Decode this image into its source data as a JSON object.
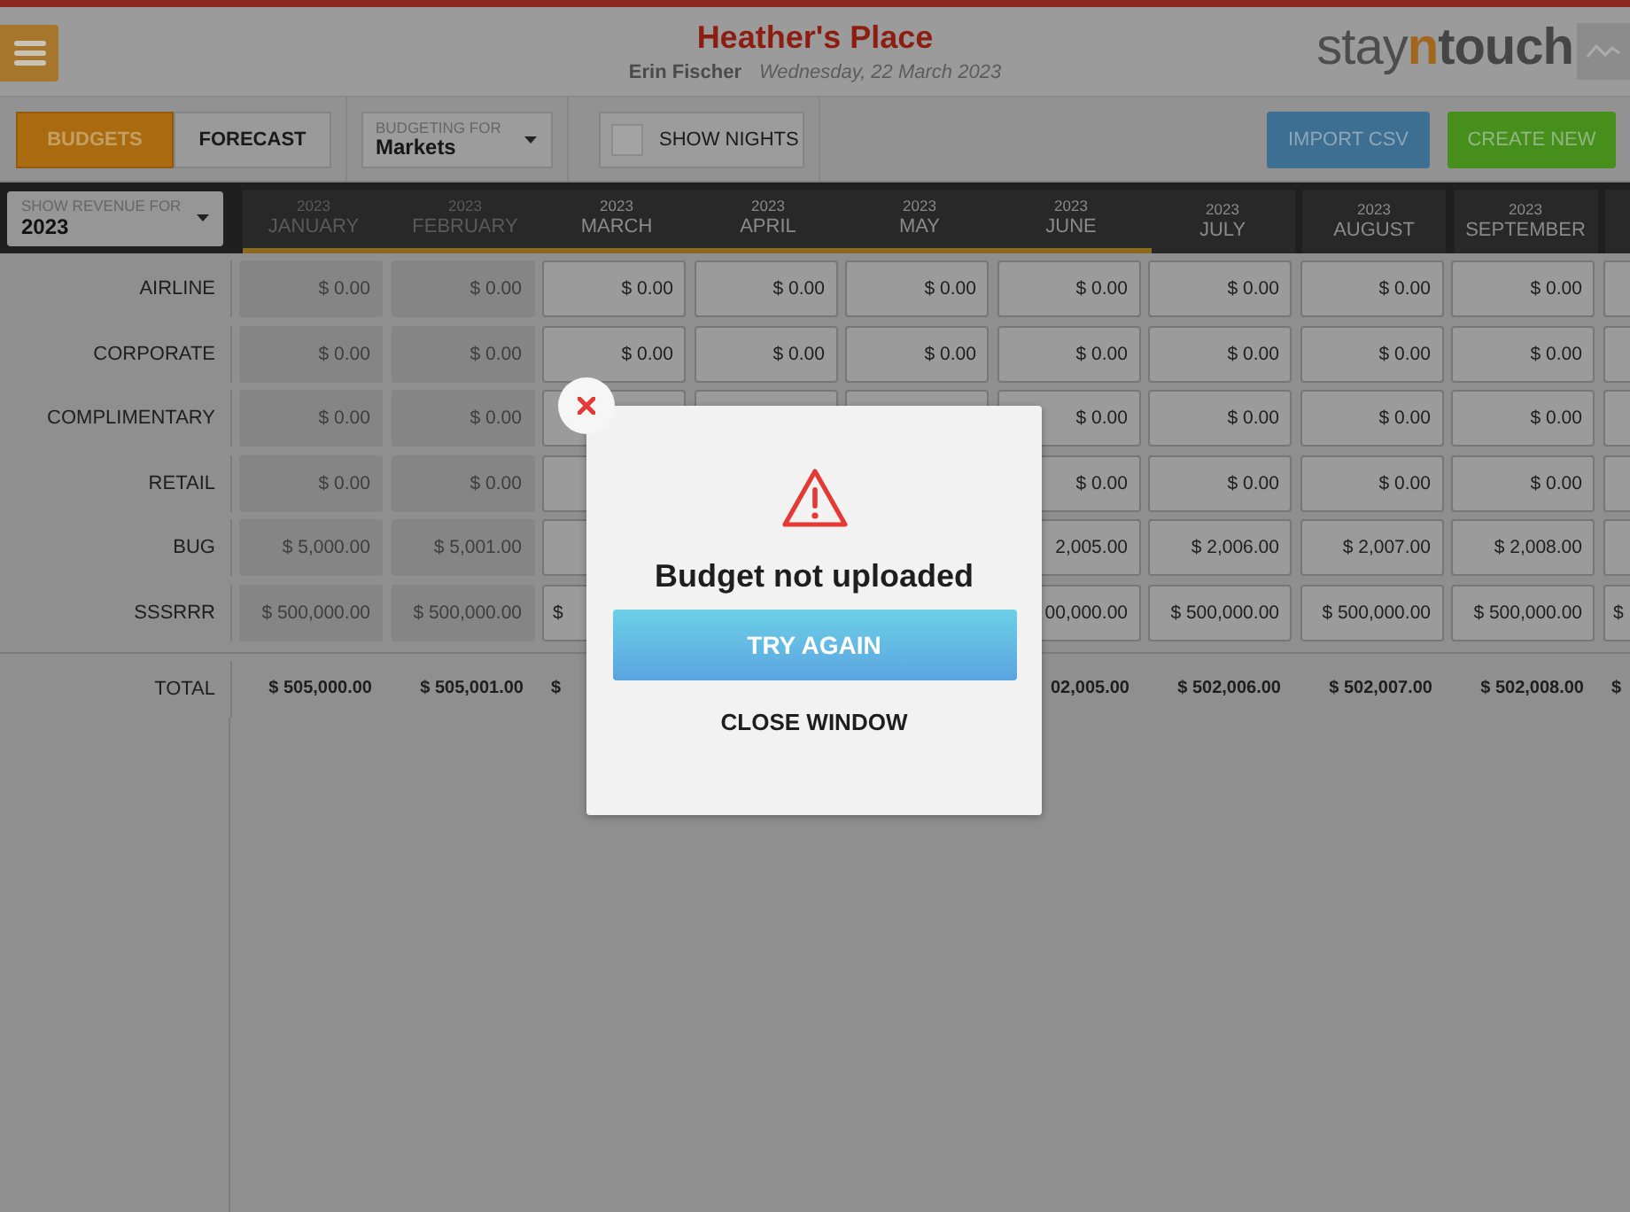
{
  "header": {
    "hotel": "Heather's Place",
    "user": "Erin Fischer",
    "date": "Wednesday, 22 March 2023",
    "logo": [
      "stay",
      "n",
      "touch"
    ]
  },
  "toolbar": {
    "tabs": [
      {
        "label": "BUDGETS",
        "selected": true
      },
      {
        "label": "FORECAST",
        "selected": false
      }
    ],
    "budgeting_for": {
      "label": "BUDGETING FOR",
      "value": "Markets"
    },
    "show_nights": {
      "label": "SHOW NIGHTS",
      "checked": false
    },
    "buttons": [
      {
        "label": "IMPORT CSV",
        "kind": "import"
      },
      {
        "label": "CREATE NEW",
        "kind": "create"
      }
    ]
  },
  "revenue_for": {
    "label": "SHOW REVENUE FOR",
    "value": "2023"
  },
  "months": [
    {
      "year": "2023",
      "name": "JANUARY",
      "past": true,
      "underlined": true
    },
    {
      "year": "2023",
      "name": "FEBRUARY",
      "past": true,
      "underlined": true
    },
    {
      "year": "2023",
      "name": "MARCH",
      "past": false,
      "underlined": true
    },
    {
      "year": "2023",
      "name": "APRIL",
      "past": false,
      "underlined": true
    },
    {
      "year": "2023",
      "name": "MAY",
      "past": false,
      "underlined": true
    },
    {
      "year": "2023",
      "name": "JUNE",
      "past": false,
      "underlined": true
    },
    {
      "year": "2023",
      "name": "JULY",
      "past": false,
      "underlined": false
    },
    {
      "year": "2023",
      "name": "AUGUST",
      "past": false,
      "underlined": false
    },
    {
      "year": "2023",
      "name": "SEPTEMBER",
      "past": false,
      "underlined": false
    }
  ],
  "rows": [
    {
      "label": "AIRLINE",
      "cells": [
        {
          "value": "$ 0.00",
          "disabled": true
        },
        {
          "value": "$ 0.00",
          "disabled": true
        },
        {
          "value": "$ 0.00",
          "disabled": false
        },
        {
          "value": "$ 0.00",
          "disabled": false
        },
        {
          "value": "$ 0.00",
          "disabled": false
        },
        {
          "value": "$ 0.00",
          "disabled": false
        },
        {
          "value": "$ 0.00",
          "disabled": false
        },
        {
          "value": "$ 0.00",
          "disabled": false
        },
        {
          "value": "$ 0.00",
          "disabled": false
        },
        {
          "disabled": false
        }
      ]
    },
    {
      "label": "CORPORATE",
      "cells": [
        {
          "value": "$ 0.00",
          "disabled": true
        },
        {
          "value": "$ 0.00",
          "disabled": true
        },
        {
          "value": "$ 0.00",
          "disabled": false
        },
        {
          "value": "$ 0.00",
          "disabled": false
        },
        {
          "value": "$ 0.00",
          "disabled": false
        },
        {
          "value": "$ 0.00",
          "disabled": false
        },
        {
          "value": "$ 0.00",
          "disabled": false
        },
        {
          "value": "$ 0.00",
          "disabled": false
        },
        {
          "value": "$ 0.00",
          "disabled": false
        },
        {
          "disabled": false
        }
      ]
    },
    {
      "label": "COMPLIMENTARY",
      "cells": [
        {
          "value": "$ 0.00",
          "disabled": true
        },
        {
          "value": "$ 0.00",
          "disabled": true
        },
        {
          "disabled": false
        },
        {
          "disabled": false
        },
        {
          "disabled": false
        }
      ],
      "cells_right": [
        {
          "value": "$ 0.00",
          "disabled": false
        },
        {
          "value": "$ 0.00",
          "disabled": false
        },
        {
          "value": "$ 0.00",
          "disabled": false
        },
        {
          "value": "$ 0.00",
          "disabled": false
        },
        {
          "disabled": false
        }
      ]
    },
    {
      "label": "RETAIL",
      "cells": [
        {
          "value": "$ 0.00",
          "disabled": true
        },
        {
          "value": "$ 0.00",
          "disabled": true
        },
        {
          "disabled": false
        }
      ],
      "cells_right": [
        {
          "value": "$ 0.00",
          "disabled": false
        },
        {
          "value": "$ 0.00",
          "disabled": false
        },
        {
          "value": "$ 0.00",
          "disabled": false
        },
        {
          "value": "$ 0.00",
          "disabled": false
        },
        {
          "disabled": false
        }
      ]
    },
    {
      "label": "BUG",
      "cells": [
        {
          "value": "$ 5,000.00",
          "disabled": true
        },
        {
          "value": "$ 5,001.00",
          "disabled": true
        },
        {
          "disabled": false
        }
      ],
      "cells_right": [
        {
          "value": "2,005.00",
          "disabled": false
        },
        {
          "value": "$ 2,006.00",
          "disabled": false
        },
        {
          "value": "$ 2,007.00",
          "disabled": false
        },
        {
          "value": "$ 2,008.00",
          "disabled": false
        },
        {
          "disabled": false
        }
      ]
    },
    {
      "label": "SSSRRR",
      "cells": [
        {
          "value": "$ 500,000.00",
          "disabled": true
        },
        {
          "value": "$ 500,000.00",
          "disabled": true
        },
        {
          "value": "$",
          "disabled": false,
          "clipped": true
        }
      ],
      "cells_right": [
        {
          "value": "00,000.00",
          "disabled": false
        },
        {
          "value": "$ 500,000.00",
          "disabled": false
        },
        {
          "value": "$ 500,000.00",
          "disabled": false
        },
        {
          "value": "$ 500,000.00",
          "disabled": false
        },
        {
          "value": "$",
          "disabled": false,
          "clipped": true
        }
      ]
    }
  ],
  "totals": {
    "label": "TOTAL",
    "values": [
      {
        "value": "$ 505,000.00"
      },
      {
        "value": "$ 505,001.00"
      },
      {
        "value": "$",
        "clipped": true
      }
    ],
    "values_right": [
      {
        "value": "02,005.00"
      },
      {
        "value": "$ 502,006.00"
      },
      {
        "value": "$ 502,007.00"
      },
      {
        "value": "$ 502,008.00"
      },
      {
        "value": "$",
        "clipped": true
      }
    ]
  },
  "dialog": {
    "message": "Budget not uploaded",
    "primary": "TRY AGAIN",
    "secondary": "CLOSE WINDOW"
  }
}
